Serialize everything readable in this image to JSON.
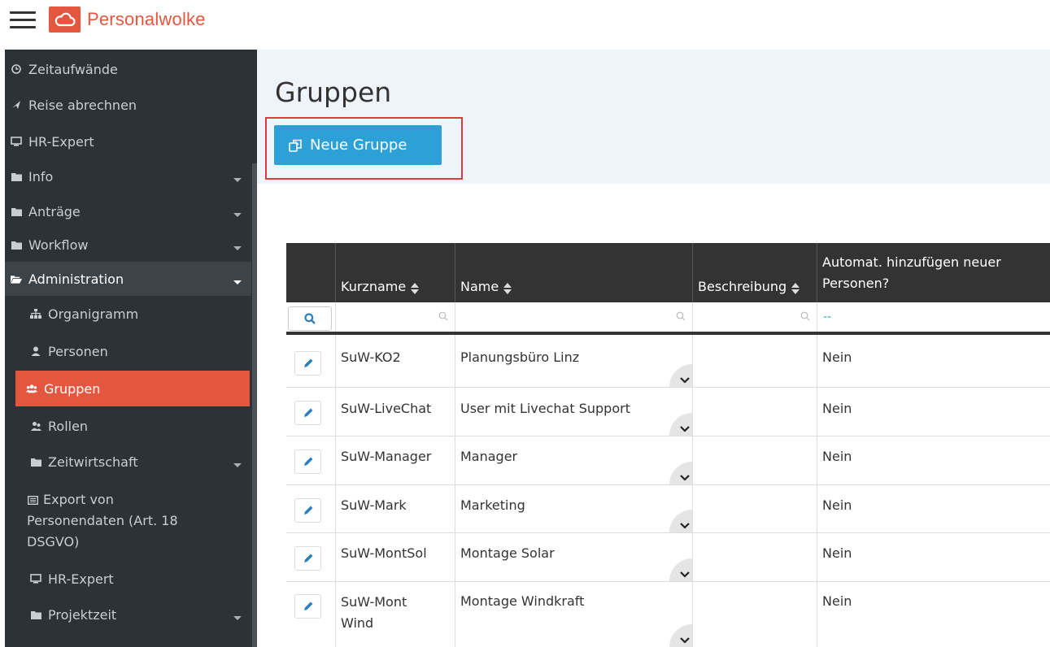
{
  "brand": {
    "name": "Personalwolke",
    "accent": "#e4563f"
  },
  "sidebar": {
    "items": [
      {
        "label": "Zeitaufwände",
        "icon": "clock-icon"
      },
      {
        "label": "Reise abrechnen",
        "icon": "plane-icon"
      },
      {
        "label": "HR-Expert",
        "icon": "monitor-icon"
      },
      {
        "label": "Info",
        "icon": "folder-icon"
      },
      {
        "label": "Anträge",
        "icon": "folder-icon"
      },
      {
        "label": "Workflow",
        "icon": "folder-icon"
      },
      {
        "label": "Administration",
        "icon": "folder-open-icon"
      },
      {
        "label": "Organigramm",
        "icon": "sitemap-icon"
      },
      {
        "label": "Personen",
        "icon": "user-icon"
      },
      {
        "label": "Gruppen",
        "icon": "users-icon"
      },
      {
        "label": "Rollen",
        "icon": "user-roles-icon"
      },
      {
        "label": "Zeitwirtschaft",
        "icon": "folder-icon"
      },
      {
        "label": "Export von Personendaten (Art. 18 DSGVO)",
        "icon": "list-icon"
      },
      {
        "label": "HR-Expert",
        "icon": "monitor-icon"
      },
      {
        "label": "Projektzeit",
        "icon": "folder-icon"
      }
    ]
  },
  "page": {
    "title": "Gruppen",
    "new_button": "Neue Gruppe"
  },
  "table": {
    "columns": [
      "Kurzname",
      "Name",
      "Beschreibung",
      "Automat. hinzufügen neuer Personen?"
    ],
    "filter_auto_value": "--",
    "rows": [
      {
        "kurzname": "SuW-KO2",
        "name": "Planungsbüro Linz",
        "beschreibung": "",
        "auto": "Nein"
      },
      {
        "kurzname": "SuW-LiveChat",
        "name": "User mit Livechat Support",
        "beschreibung": "",
        "auto": "Nein"
      },
      {
        "kurzname": "SuW-Manager",
        "name": "Manager",
        "beschreibung": "",
        "auto": "Nein"
      },
      {
        "kurzname": "SuW-Mark",
        "name": "Marketing",
        "beschreibung": "",
        "auto": "Nein"
      },
      {
        "kurzname": "SuW-MontSol",
        "name": "Montage Solar",
        "beschreibung": "",
        "auto": "Nein"
      },
      {
        "kurzname": "SuW-MontWind",
        "name": "Montage Windkraft",
        "beschreibung": "",
        "auto": "Nein"
      }
    ]
  }
}
